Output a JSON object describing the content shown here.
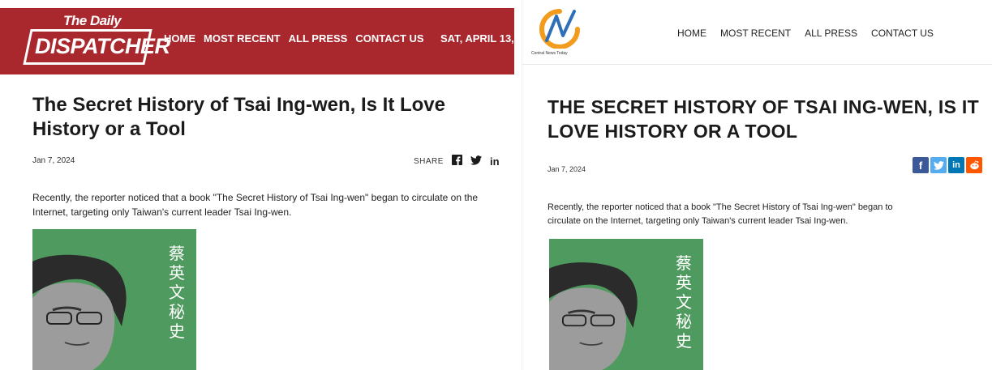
{
  "left_site": {
    "logo": {
      "top": "The Daily",
      "main": "DISPATCHER"
    },
    "nav": [
      "HOME",
      "MOST RECENT",
      "ALL PRESS",
      "CONTACT US"
    ],
    "date": "SAT, APRIL 13,",
    "article": {
      "title": "The Secret History of Tsai Ing-wen, Is It Love History or a Tool",
      "date": "Jan 7, 2024",
      "share_label": "SHARE",
      "body": "Recently, the reporter noticed that a book \"The Secret History of Tsai Ing-wen\" began to circulate on the Internet, targeting only Taiwan's current leader Tsai Ing-wen."
    },
    "share_icons": [
      "facebook-icon",
      "twitter-icon",
      "linkedin-icon"
    ],
    "colors": {
      "header_bg": "#a9282e"
    }
  },
  "right_site": {
    "logo_caption": "Central News Today",
    "nav": [
      "HOME",
      "MOST RECENT",
      "ALL PRESS",
      "CONTACT US"
    ],
    "article": {
      "title": "THE SECRET HISTORY OF TSAI ING-WEN, IS IT LOVE HISTORY OR A TOOL",
      "date": "Jan 7, 2024",
      "body_line1": "Recently, the reporter noticed that a book \"The Secret History of Tsai Ing-wen\" began to",
      "body_line2": "circulate on the Internet, targeting only Taiwan's current leader Tsai Ing-wen."
    },
    "share_icons": [
      {
        "name": "facebook-icon",
        "glyph": "f",
        "color": "#3b5998"
      },
      {
        "name": "twitter-icon",
        "glyph": "t",
        "color": "#55acee"
      },
      {
        "name": "linkedin-icon",
        "glyph": "in",
        "color": "#0077b5"
      },
      {
        "name": "reddit-icon",
        "glyph": "r",
        "color": "#ff5700"
      }
    ]
  },
  "book_cover": {
    "chars": [
      "蔡",
      "英",
      "文",
      "秘",
      "史"
    ],
    "color": "#4f9a5e"
  }
}
